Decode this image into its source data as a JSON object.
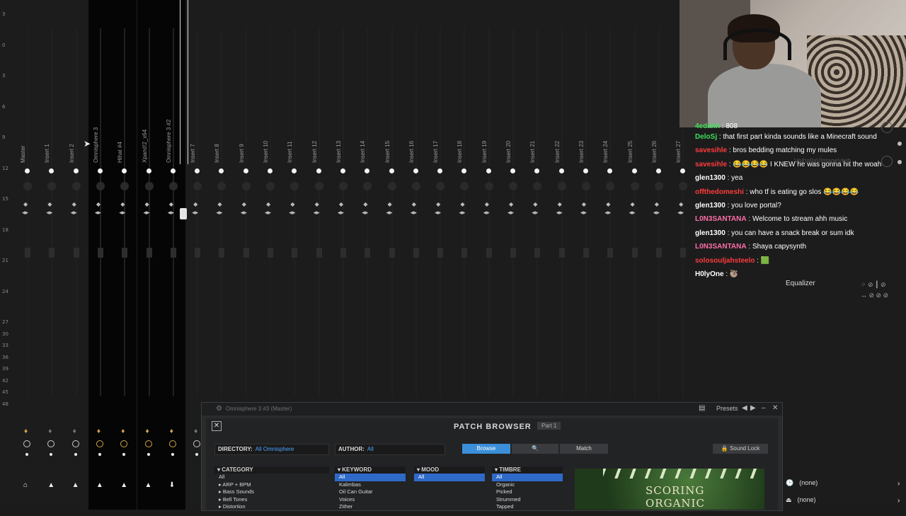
{
  "mixer": {
    "scale": [
      "3",
      "0",
      "3",
      "6",
      "9",
      "12",
      "15",
      "18",
      "21",
      "24",
      "27",
      "30",
      "33",
      "36",
      "39",
      "42",
      "45",
      "48"
    ],
    "channels": [
      {
        "name": "Master",
        "dark": false
      },
      {
        "name": "Insert 1",
        "dark": false
      },
      {
        "name": "Insert 2",
        "dark": false
      },
      {
        "name": "Omnisphere 3",
        "dark": true
      },
      {
        "name": "Hihat #4",
        "dark": true
      },
      {
        "name": "Xpand!2_x64",
        "dark": true
      },
      {
        "name": "Omnisphere 3 #2",
        "dark": true
      },
      {
        "name": "Insert 7",
        "dark": false
      },
      {
        "name": "Insert 8",
        "dark": false
      },
      {
        "name": "Insert 9",
        "dark": false
      },
      {
        "name": "Insert 10",
        "dark": false
      },
      {
        "name": "Insert 11",
        "dark": false
      },
      {
        "name": "Insert 12",
        "dark": false
      },
      {
        "name": "Insert 13",
        "dark": false
      },
      {
        "name": "Insert 14",
        "dark": false
      },
      {
        "name": "Insert 15",
        "dark": false
      },
      {
        "name": "Insert 16",
        "dark": false
      },
      {
        "name": "Insert 17",
        "dark": false
      },
      {
        "name": "Insert 18",
        "dark": false
      },
      {
        "name": "Insert 19",
        "dark": false
      },
      {
        "name": "Insert 20",
        "dark": false
      },
      {
        "name": "Insert 21",
        "dark": false
      },
      {
        "name": "Insert 22",
        "dark": false
      },
      {
        "name": "Insert 23",
        "dark": false
      },
      {
        "name": "Insert 24",
        "dark": false
      },
      {
        "name": "Insert 25",
        "dark": false
      },
      {
        "name": "Insert 26",
        "dark": false
      },
      {
        "name": "Insert 27",
        "dark": false
      }
    ]
  },
  "chat": {
    "top_partial": {
      "user": "4edahh",
      "text": "808"
    },
    "messages": [
      {
        "user": "DeloSj",
        "color": "#3ee05a",
        "text": "that first part kinda sounds like a Minecraft sound"
      },
      {
        "user": "savesihle",
        "color": "#ff3b3b",
        "text": "bros bedding matching my mules"
      },
      {
        "user": "savesihle",
        "color": "#ff3b3b",
        "text": "😂😂😂😂 I KNEW he was gonna hit the woah"
      },
      {
        "user": "glen1300",
        "color": "#ffffff",
        "text": "yea"
      },
      {
        "user": "offthedomeshi",
        "color": "#ff3b3b",
        "text": "who tf is eating go slos 😂😂😂😂"
      },
      {
        "user": "glen1300",
        "color": "#ffffff",
        "text": "you love portal?"
      },
      {
        "user": "L0N3SANTANA",
        "color": "#ff6fa8",
        "text": "Welcome to stream ahh music"
      },
      {
        "user": "glen1300",
        "color": "#ffffff",
        "text": "you can have a snack break or sum idk"
      },
      {
        "user": "L0N3SANTANA",
        "color": "#ff6fa8",
        "text": "Shaya capysynth"
      },
      {
        "user": "solosouljahsteelo",
        "color": "#ff3b3b",
        "text": "🟩"
      },
      {
        "user": "H0lyOne",
        "color": "#ffffff",
        "text": "🦥"
      }
    ],
    "overlay_plugin": "ValhallaVintageVerb"
  },
  "equalizer_label": "Equalizer",
  "patch_browser": {
    "window_title": "Omnisphere 3 #3 (Master)",
    "presets_label": "Presets",
    "title": "PATCH BROWSER",
    "part": "Part 1",
    "directory_label": "DIRECTORY:",
    "directory_value": "All Omnisphere",
    "author_label": "AUTHOR:",
    "author_value": "All",
    "tabs": {
      "browse": "Browse",
      "match": "Match"
    },
    "sound_lock": "Sound Lock",
    "columns": [
      {
        "header": "CATEGORY",
        "rows": [
          "All",
          "▸ ARP + BPM",
          "▸ Bass Sounds",
          "▸ Bell Tones",
          "▸ Distortion"
        ]
      },
      {
        "header": "KEYWORD",
        "rows": [
          "All",
          "Kalimbas",
          "Oil Can Guitar",
          "Voices",
          "Zither"
        ]
      },
      {
        "header": "MOOD",
        "rows": [
          "All"
        ]
      },
      {
        "header": "TIMBRE",
        "rows": [
          "All",
          "Organic",
          "Picked",
          "Strummed",
          "Tapped"
        ]
      }
    ],
    "artwork_text": "SCORING ORGANIC"
  },
  "bottom_right": {
    "slot1": "(none)",
    "slot2": "(none)"
  },
  "colors": {
    "accent_blue": "#2f6ac9",
    "bulb": "#d4a64a"
  }
}
